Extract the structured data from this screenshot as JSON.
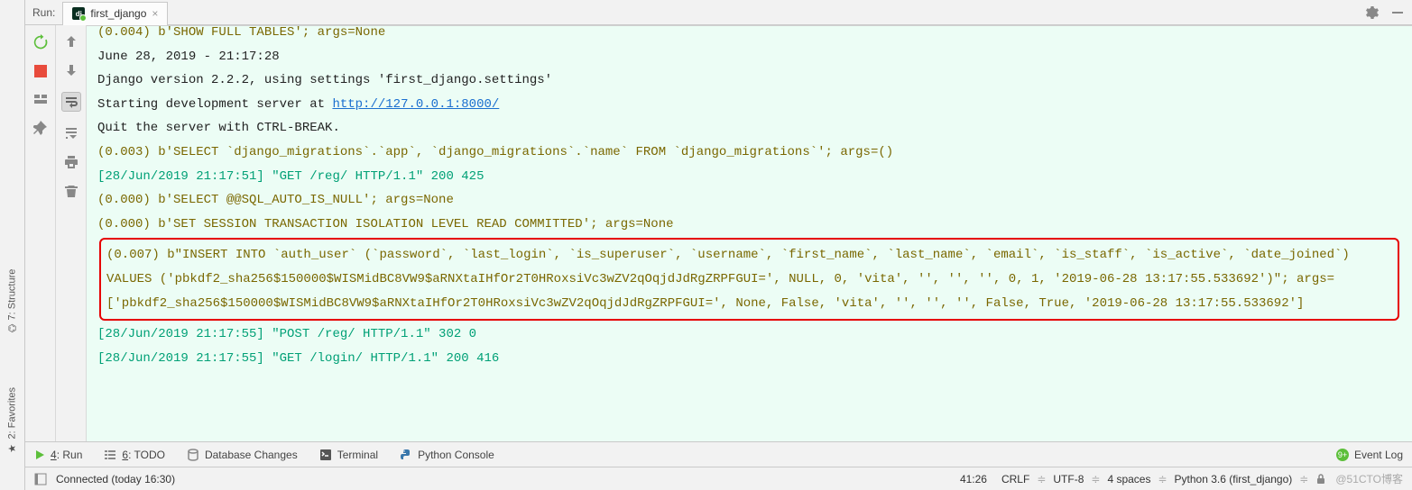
{
  "header": {
    "run_label": "Run:",
    "tab_name": "first_django"
  },
  "sidebar_tabs": {
    "structure": "7: Structure",
    "favorites": "2: Favorites"
  },
  "console": {
    "truncated": "(0.004) b'SHOW FULL TABLES'; args=None",
    "date_line": "June 28, 2019 - 21:17:28",
    "version_line": "Django version 2.2.2, using settings 'first_django.settings'",
    "server_prefix": "Starting development server at ",
    "server_url": "http://127.0.0.1:8000/",
    "quit_line": "Quit the server with CTRL-BREAK.",
    "sql1": "(0.003) b'SELECT `django_migrations`.`app`, `django_migrations`.`name` FROM `django_migrations`'; args=()",
    "log1": "[28/Jun/2019 21:17:51] \"GET /reg/ HTTP/1.1\" 200 425",
    "sql2": "(0.000) b'SELECT @@SQL_AUTO_IS_NULL'; args=None",
    "sql3": "(0.000) b'SET SESSION TRANSACTION ISOLATION LEVEL READ COMMITTED'; args=None",
    "sql_insert": "(0.007) b\"INSERT INTO `auth_user` (`password`, `last_login`, `is_superuser`, `username`, `first_name`, `last_name`, `email`, `is_staff`, `is_active`, `date_joined`) VALUES ('pbkdf2_sha256$150000$WISMidBC8VW9$aRNXtaIHfOr2T0HRoxsiVc3wZV2qOqjdJdRgZRPFGUI=', NULL, 0, 'vita', '', '', '', 0, 1, '2019-06-28 13:17:55.533692')\"; args=['pbkdf2_sha256$150000$WISMidBC8VW9$aRNXtaIHfOr2T0HRoxsiVc3wZV2qOqjdJdRgZRPFGUI=', None, False, 'vita', '', '', '', False, True, '2019-06-28 13:17:55.533692']",
    "log2": "[28/Jun/2019 21:17:55] \"POST /reg/ HTTP/1.1\" 302 0",
    "log3": "[28/Jun/2019 21:17:55] \"GET /login/ HTTP/1.1\" 200 416"
  },
  "bottom": {
    "run": "4: Run",
    "todo": "6: TODO",
    "db": "Database Changes",
    "terminal": "Terminal",
    "pyconsole": "Python Console",
    "event_log": "Event Log",
    "badge": "9+"
  },
  "status": {
    "connected": "Connected (today 16:30)",
    "pos": "41:26",
    "eol": "CRLF",
    "enc": "UTF-8",
    "indent": "4 spaces",
    "interp": "Python 3.6 (first_django)",
    "watermark": "@51CTO博客"
  }
}
